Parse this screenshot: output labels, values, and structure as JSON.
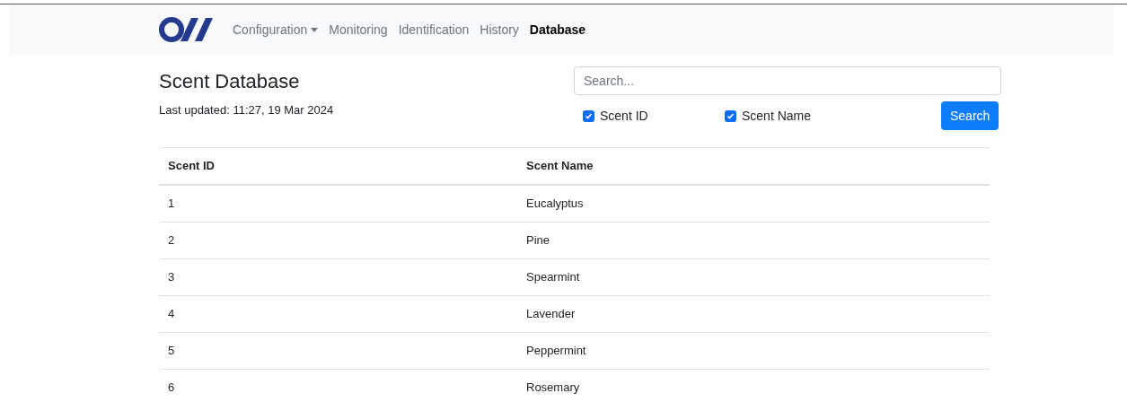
{
  "nav": {
    "items": [
      {
        "label": "Configuration",
        "kind": "dropdown",
        "selected": false
      },
      {
        "label": "Monitoring",
        "kind": "link",
        "selected": false
      },
      {
        "label": "Identification",
        "kind": "link",
        "selected": false
      },
      {
        "label": "History",
        "kind": "link",
        "selected": false
      },
      {
        "label": "Database",
        "kind": "link",
        "selected": true
      }
    ]
  },
  "title": "Scent Database",
  "last_updated": "Last updated: 11:27, 19 Mar 2024",
  "search": {
    "placeholder": "Search...",
    "filters": [
      {
        "label": "Scent ID",
        "checked": true
      },
      {
        "label": "Scent Name",
        "checked": true
      }
    ],
    "button": "Search"
  },
  "table": {
    "columns": [
      "Scent ID",
      "Scent Name"
    ],
    "rows": [
      [
        "1",
        "Eucalyptus"
      ],
      [
        "2",
        "Pine"
      ],
      [
        "3",
        "Spearmint"
      ],
      [
        "4",
        "Lavender"
      ],
      [
        "5",
        "Peppermint"
      ],
      [
        "6",
        "Rosemary"
      ]
    ]
  }
}
